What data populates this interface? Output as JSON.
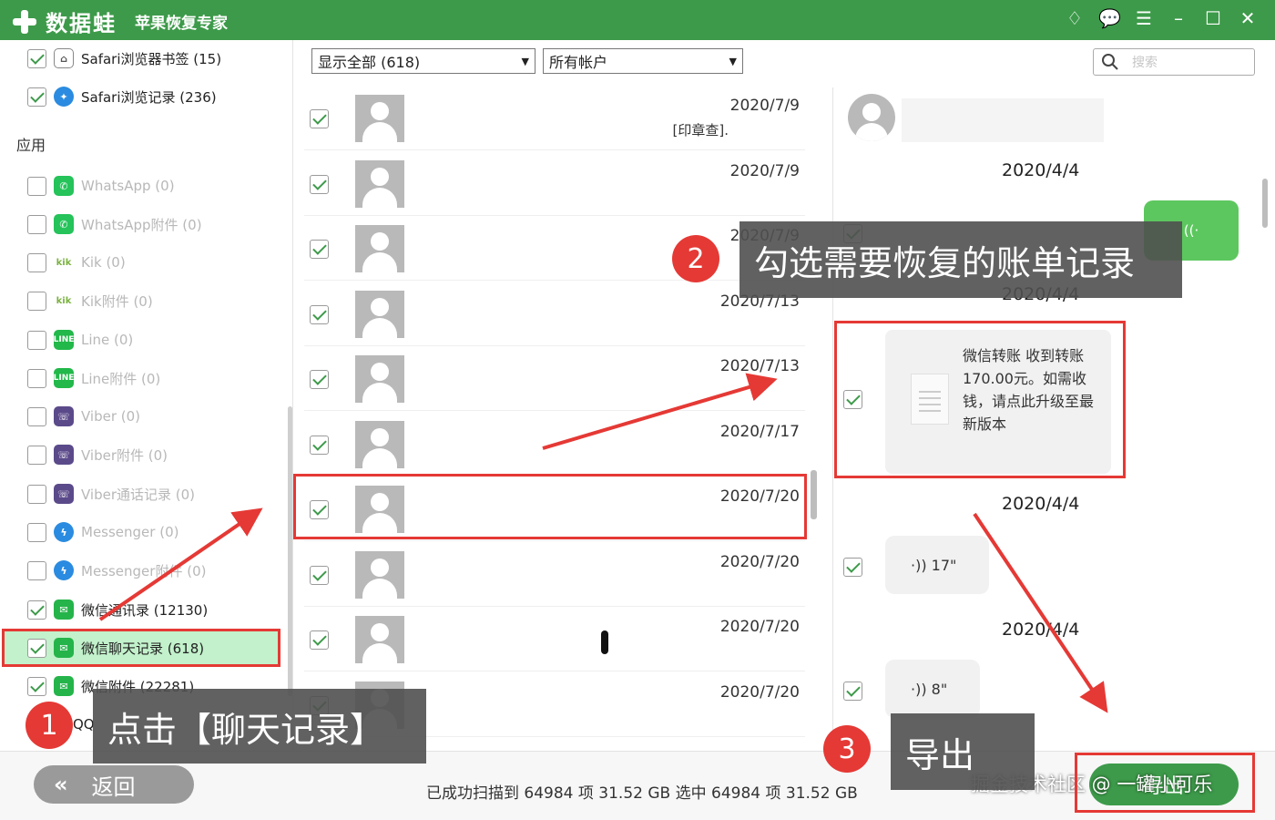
{
  "titlebar": {
    "app_name": "数据蛙",
    "subtitle": "苹果恢复专家",
    "icons": [
      "diamond-icon",
      "chat-bubble-icon",
      "menu-icon",
      "minimize-icon",
      "maximize-icon",
      "close-icon"
    ],
    "icon_glyphs": [
      "♢",
      "💬",
      "☰",
      "–",
      "☐",
      "✕"
    ],
    "color": "#3d9a4a"
  },
  "sidebar": {
    "section_label": "应用",
    "top_items": [
      {
        "label": "Safari浏览器书签 (15)",
        "checked": true,
        "icon": "bookmark-icon"
      },
      {
        "label": "Safari浏览记录 (236)",
        "checked": true,
        "icon": "safari-icon"
      }
    ],
    "app_items": [
      {
        "label": "WhatsApp (0)",
        "checked": false,
        "icon": "whatsapp-icon"
      },
      {
        "label": "WhatsApp附件 (0)",
        "checked": false,
        "icon": "whatsapp-icon"
      },
      {
        "label": "Kik (0)",
        "checked": false,
        "icon": "kik-icon"
      },
      {
        "label": "Kik附件 (0)",
        "checked": false,
        "icon": "kik-icon"
      },
      {
        "label": "Line (0)",
        "checked": false,
        "icon": "line-icon"
      },
      {
        "label": "Line附件 (0)",
        "checked": false,
        "icon": "line-icon"
      },
      {
        "label": "Viber (0)",
        "checked": false,
        "icon": "viber-icon"
      },
      {
        "label": "Viber附件 (0)",
        "checked": false,
        "icon": "viber-icon"
      },
      {
        "label": "Viber通话记录 (0)",
        "checked": false,
        "icon": "viber-icon"
      },
      {
        "label": "Messenger (0)",
        "checked": false,
        "icon": "messenger-icon"
      },
      {
        "label": "Messenger附件 (0)",
        "checked": false,
        "icon": "messenger-icon"
      },
      {
        "label": "微信通讯录 (12130)",
        "checked": true,
        "icon": "wechat-icon"
      },
      {
        "label": "微信聊天记录 (618)",
        "checked": true,
        "icon": "wechat-icon"
      },
      {
        "label": "微信附件 (22281)",
        "checked": true,
        "icon": "wechat-icon"
      },
      {
        "label": "QQ",
        "checked": false,
        "icon": "qq-icon"
      }
    ]
  },
  "filters": {
    "show_all": "显示全部 (618)",
    "accounts": "所有帐户",
    "search_placeholder": "搜索"
  },
  "conversations": [
    {
      "date": "2020/7/9",
      "snippet": "[印章查]."
    },
    {
      "date": "2020/7/9",
      "snippet": ""
    },
    {
      "date": "2020/7/9",
      "snippet": ""
    },
    {
      "date": "2020/7/13",
      "snippet": ""
    },
    {
      "date": "2020/7/13",
      "snippet": ""
    },
    {
      "date": "2020/7/17",
      "snippet": ""
    },
    {
      "date": "2020/7/20",
      "snippet": ""
    },
    {
      "date": "2020/7/20",
      "snippet": ""
    },
    {
      "date": "2020/7/20",
      "snippet": ""
    },
    {
      "date": "2020/7/20",
      "snippet": ""
    }
  ],
  "chat": {
    "dates": [
      "2020/4/4",
      "2020/4/4",
      "2020/4/4",
      "2020/4/4"
    ],
    "voice_out_label": "((·",
    "transfer_card": "微信转账 收到转账170.00元。如需收钱，请点此升级至最新版本",
    "voice_messages": [
      "·)) 17\"",
      "·)) 8\""
    ]
  },
  "annotations": {
    "step1_number": "1",
    "step1_text": "点击【聊天记录】",
    "step2_number": "2",
    "step2_text": "勾选需要恢复的账单记录",
    "step3_number": "3",
    "step3_text": "导出",
    "highlight_color": "#e53935"
  },
  "footer": {
    "back_label": "返回",
    "back_icon": "double-chevron-left-icon",
    "status_text": "已成功扫描到 64984 项 31.52 GB  选中 64984 项 31.52 GB",
    "export_label": "导出",
    "watermark": "掘金技术社区 @ 一罐小可乐"
  }
}
